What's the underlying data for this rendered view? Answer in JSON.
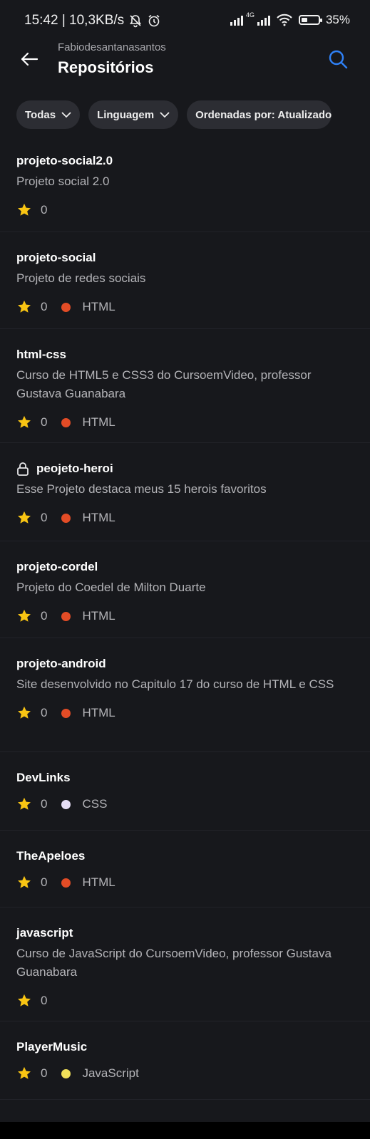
{
  "status": {
    "time_speed": "15:42 | 10,3KB/s",
    "network": "4G",
    "battery": "35%",
    "battery_level": 0.35
  },
  "header": {
    "owner": "Fabiodesantanasantos",
    "title": "Repositórios"
  },
  "filters": [
    {
      "label": "Todas"
    },
    {
      "label": "Linguagem"
    },
    {
      "label": "Ordenadas por: Atualizado"
    }
  ],
  "colors": {
    "html": "#e34c26",
    "css": "#e4dcf4",
    "javascript": "#f1e05a",
    "star": "#f9c513",
    "accent": "#2f81f7"
  },
  "repos": [
    {
      "name": "projeto-social2.0",
      "description": "Projeto social 2.0",
      "stars": "0",
      "language": "",
      "private": false
    },
    {
      "name": "projeto-social",
      "description": "Projeto de redes sociais",
      "stars": "0",
      "language": "HTML",
      "private": false
    },
    {
      "name": "html-css",
      "description": "Curso de HTML5 e CSS3 do CursoemVideo, professor Gustava Guanabara",
      "stars": "0",
      "language": "HTML",
      "private": false
    },
    {
      "name": "peojeto-heroi",
      "description": "Esse Projeto destaca meus 15 herois favoritos",
      "stars": "0",
      "language": "HTML",
      "private": true
    },
    {
      "name": "projeto-cordel",
      "description": "Projeto do Coedel de Milton Duarte",
      "stars": "0",
      "language": "HTML",
      "private": false
    },
    {
      "name": "projeto-android",
      "description": "Site desenvolvido no Capitulo 17 do curso de HTML e CSS",
      "stars": "0",
      "language": "HTML",
      "private": false
    },
    {
      "name": "DevLinks",
      "description": "",
      "stars": "0",
      "language": "CSS",
      "private": false
    },
    {
      "name": "TheApeloes",
      "description": "",
      "stars": "0",
      "language": "HTML",
      "private": false
    },
    {
      "name": "javascript",
      "description": "Curso de JavaScript do CursoemVideo, professor Gustava Guanabara",
      "stars": "0",
      "language": "",
      "private": false
    },
    {
      "name": "PlayerMusic",
      "description": "",
      "stars": "0",
      "language": "JavaScript",
      "private": false
    }
  ]
}
